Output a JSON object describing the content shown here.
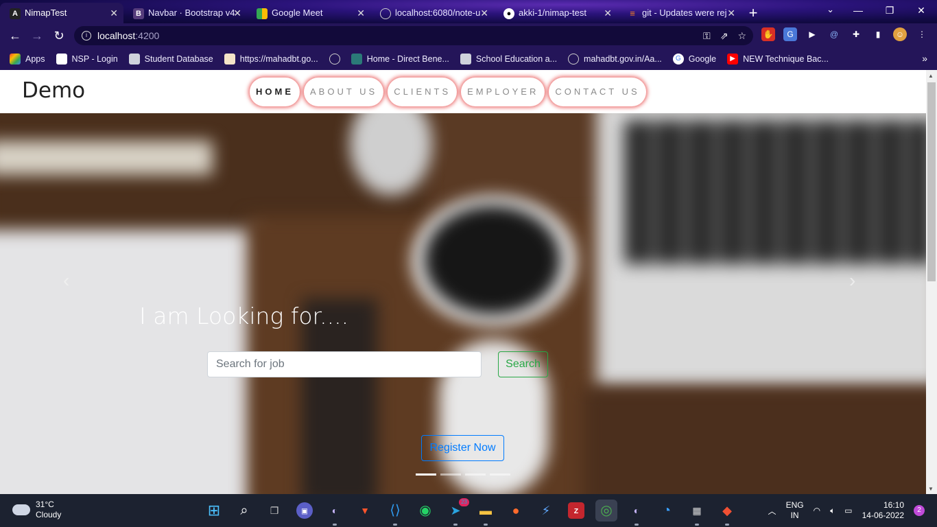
{
  "browser": {
    "tabs": [
      {
        "title": "NimapTest",
        "icon": "angular-icon",
        "active": true
      },
      {
        "title": "Navbar · Bootstrap v4",
        "icon": "bootstrap-icon",
        "active": false
      },
      {
        "title": "Google Meet",
        "icon": "meet-icon",
        "active": false
      },
      {
        "title": "localhost:6080/note-u",
        "icon": "globe-icon",
        "active": false
      },
      {
        "title": "akki-1/nimap-test",
        "icon": "github-icon",
        "active": false
      },
      {
        "title": "git - Updates were rej",
        "icon": "stackoverflow-icon",
        "active": false
      }
    ],
    "url_host": "localhost",
    "url_port": ":4200",
    "bookmarks": [
      {
        "label": "Apps",
        "icon": "apps-grid-icon"
      },
      {
        "label": "NSP - Login",
        "icon": "nsp-icon"
      },
      {
        "label": "Student Database",
        "icon": "database-icon"
      },
      {
        "label": "https://mahadbt.go...",
        "icon": "image-icon"
      },
      {
        "label": "",
        "icon": "globe-icon"
      },
      {
        "label": "Home - Direct Bene...",
        "icon": "dbt-icon"
      },
      {
        "label": "School Education a...",
        "icon": "database-icon"
      },
      {
        "label": "mahadbt.gov.in/Aa...",
        "icon": "globe-icon"
      },
      {
        "label": "Google",
        "icon": "google-icon"
      },
      {
        "label": "NEW Technique Bac...",
        "icon": "youtube-icon"
      }
    ]
  },
  "site": {
    "brand": "Demo",
    "nav": [
      "HOME",
      "ABOUT US",
      "CLIENTS",
      "EMPLOYER",
      "CONTACT US"
    ],
    "active_nav": "HOME",
    "headline": "I am Looking for....",
    "search_placeholder": "Search for job",
    "search_button": "Search",
    "register_button": "Register Now",
    "carousel_slides": 4,
    "carousel_active": 1,
    "colors": {
      "success": "#28a745",
      "primary": "#007bff",
      "nav_glow": "#e64646"
    }
  },
  "taskbar": {
    "temperature": "31°C",
    "weather": "Cloudy",
    "telegram_badge": "23",
    "lang_top": "ENG",
    "lang_bottom": "IN",
    "time": "16:10",
    "date": "14-06-2022",
    "notifications": "2"
  }
}
